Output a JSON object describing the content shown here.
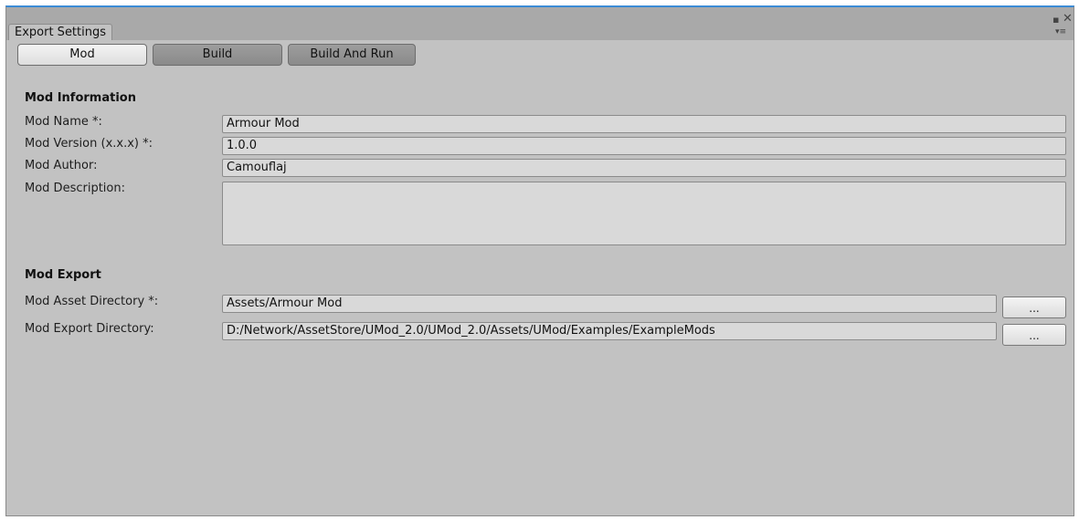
{
  "window": {
    "tab_title": "Export Settings",
    "controls": {
      "maximize_glyph": "▪",
      "close_glyph": "✕",
      "menu_glyph": "▾≡"
    }
  },
  "toolbar": {
    "mod_label": "Mod",
    "build_label": "Build",
    "build_and_run_label": "Build And Run"
  },
  "mod_information": {
    "heading": "Mod Information",
    "name_label": "Mod Name *:",
    "name_value": "Armour Mod",
    "version_label": "Mod Version (x.x.x) *:",
    "version_value": "1.0.0",
    "author_label": "Mod Author:",
    "author_value": "Camouflaj",
    "description_label": "Mod Description:",
    "description_value": ""
  },
  "mod_export": {
    "heading": "Mod Export",
    "asset_dir_label": "Mod Asset Directory *:",
    "asset_dir_value": "Assets/Armour Mod",
    "export_dir_label": "Mod Export Directory:",
    "export_dir_value": "D:/Network/AssetStore/UMod_2.0/UMod_2.0/Assets/UMod/Examples/ExampleMods",
    "browse_label": "..."
  },
  "colors": {
    "panel_bg": "#c2c2c2",
    "tabbar_bg": "#a9a9a9",
    "field_bg": "#d9d9d9",
    "accent_top_border": "#3b8bd6"
  }
}
